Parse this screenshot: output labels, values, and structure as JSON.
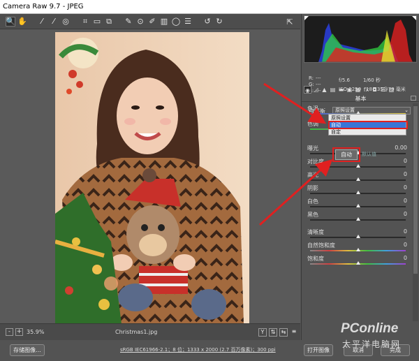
{
  "window": {
    "title": "Camera Raw 9.7 - JPEG"
  },
  "toolbar": {
    "tools": [
      {
        "icon": "zoom-icon",
        "glyph": "🔍"
      },
      {
        "icon": "hand-icon",
        "glyph": "✋"
      },
      {
        "icon": "white-balance-icon",
        "glyph": "⁄"
      },
      {
        "icon": "color-sampler-icon",
        "glyph": "⁄"
      },
      {
        "icon": "target-adjust-icon",
        "glyph": "◎"
      },
      {
        "icon": "crop-icon",
        "glyph": "⌗"
      },
      {
        "icon": "straighten-icon",
        "glyph": "▭"
      },
      {
        "icon": "transform-icon",
        "glyph": "⧉"
      },
      {
        "icon": "spot-removal-icon",
        "glyph": "✎"
      },
      {
        "icon": "red-eye-icon",
        "glyph": "⊙"
      },
      {
        "icon": "adjustment-brush-icon",
        "glyph": "✐"
      },
      {
        "icon": "graduated-filter-icon",
        "glyph": "▥"
      },
      {
        "icon": "radial-filter-icon",
        "glyph": "◯"
      },
      {
        "icon": "preferences-icon",
        "glyph": "☰"
      },
      {
        "icon": "rotate-ccw-icon",
        "glyph": "↺"
      },
      {
        "icon": "rotate-cw-icon",
        "glyph": "↻"
      }
    ]
  },
  "readout": {
    "r": "R:",
    "r_val": "---",
    "g": "G:",
    "g_val": "---",
    "b": "B:",
    "b_val": "---",
    "aperture": "f/5.6",
    "shutter": "1/60 秒",
    "iso": "ISO 1250",
    "lens": "18-135@79 毫米"
  },
  "panel": {
    "section_title": "基本",
    "white_balance_label": "白平衡",
    "white_balance_value": "原照设置",
    "white_balance_options": [
      "原照设置",
      "自动",
      "自定"
    ],
    "auto_button": "自动",
    "default_button": "默认值",
    "sliders": [
      {
        "label": "色温",
        "value": "",
        "pos": 0.5
      },
      {
        "label": "色调",
        "value": "",
        "pos": 0.5
      },
      {
        "label": "曝光",
        "value": "0.00",
        "pos": 0.5
      },
      {
        "label": "对比度",
        "value": "0",
        "pos": 0.5
      },
      {
        "label": "高光",
        "value": "0",
        "pos": 0.5
      },
      {
        "label": "阴影",
        "value": "0",
        "pos": 0.5
      },
      {
        "label": "白色",
        "value": "0",
        "pos": 0.5
      },
      {
        "label": "黑色",
        "value": "0",
        "pos": 0.5
      },
      {
        "label": "清晰度",
        "value": "0",
        "pos": 0.5
      },
      {
        "label": "自然饱和度",
        "value": "0",
        "pos": 0.5
      },
      {
        "label": "饱和度",
        "value": "0",
        "pos": 0.5
      }
    ]
  },
  "bottombar": {
    "zoom": "35.9%",
    "filename": "Christmas1.jpg",
    "zoom_out": "-",
    "zoom_in": "+",
    "y_button": "Y"
  },
  "footer": {
    "save_button": "存储图像...",
    "info": "sRGB IEC61966-2.1；8 位；1333 x 2000 (2.7 百万像素)；300 ppi",
    "open_button": "打开图像",
    "cancel_button": "取消",
    "done_button": "完成"
  },
  "watermark": {
    "brand": "PConline",
    "sub": "太平洋电脑网"
  },
  "colors": {
    "panel": "#535353",
    "annotation_red": "#e02020",
    "selection_blue": "#3875d7"
  }
}
